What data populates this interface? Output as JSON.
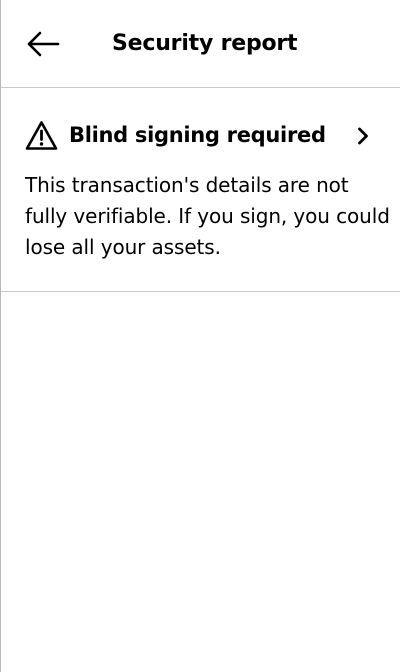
{
  "header": {
    "back_icon": "arrow-left-icon",
    "title": "Security report"
  },
  "report": {
    "icon": "warning-triangle-icon",
    "title": "Blind signing required",
    "chevron_icon": "chevron-right-icon",
    "description": "This transaction's details are not fully verifiable. If you sign, you could lose all your assets."
  }
}
